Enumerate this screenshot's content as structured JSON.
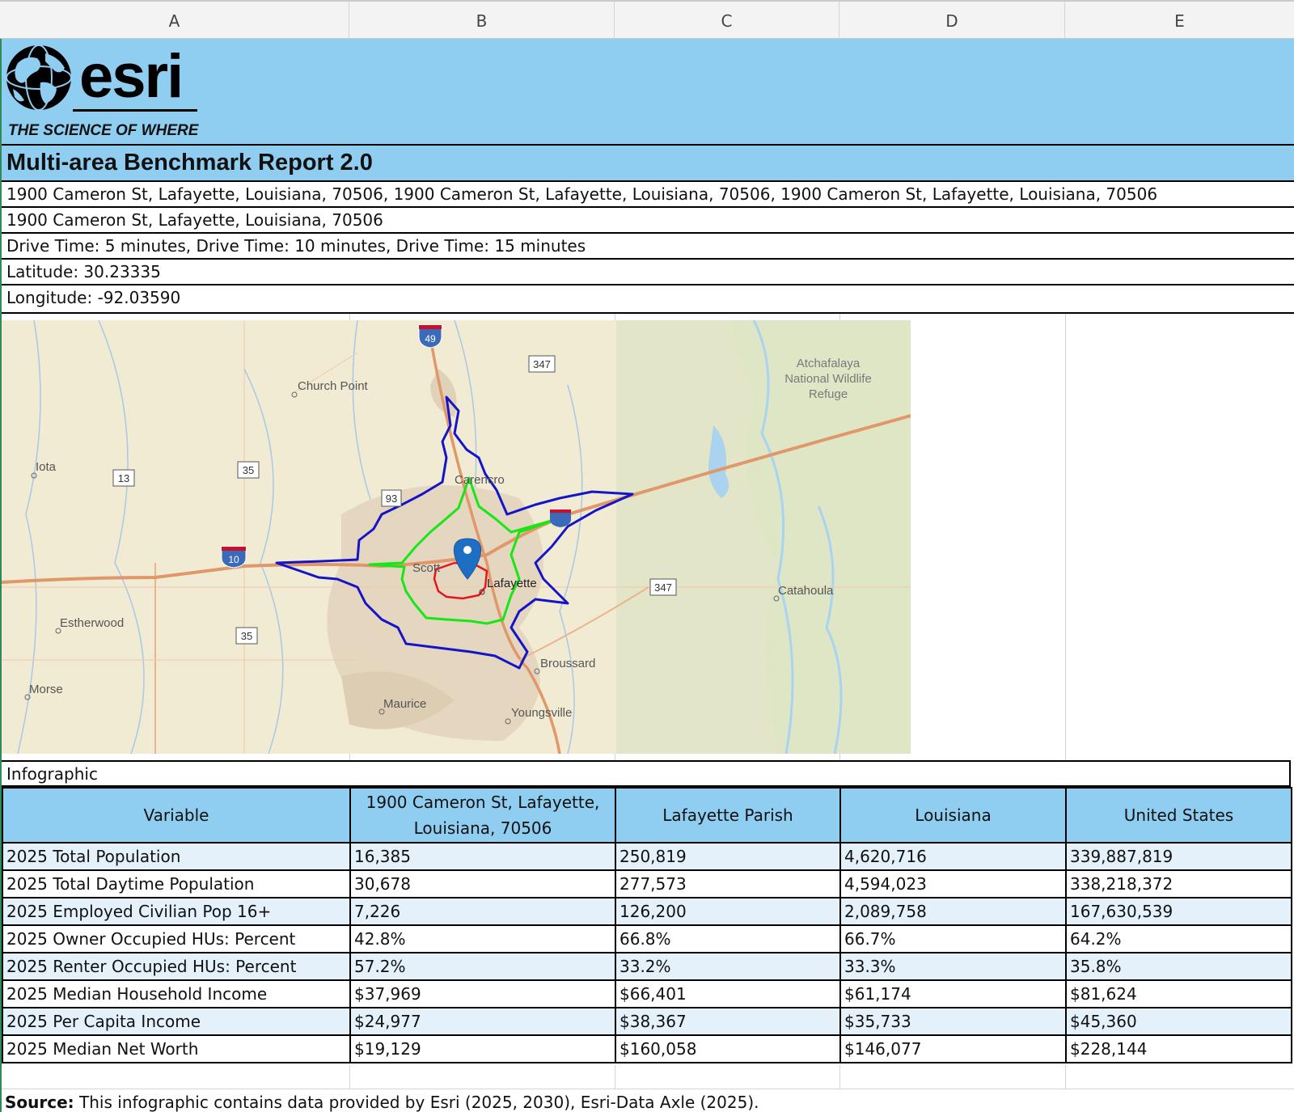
{
  "columns": [
    "A",
    "B",
    "C",
    "D",
    "E"
  ],
  "logo": {
    "word": "esri",
    "tagline": "THE SCIENCE OF WHERE",
    "brand_color": "#000000"
  },
  "report": {
    "title": "Multi-area Benchmark Report 2.0",
    "addresses": "1900 Cameron St, Lafayette, Louisiana, 70506, 1900 Cameron St, Lafayette, Louisiana, 70506, 1900 Cameron St, Lafayette, Louisiana, 70506",
    "address": "1900 Cameron St, Lafayette, Louisiana, 70506",
    "drive_times": "Drive Time: 5 minutes, Drive Time: 10 minutes, Drive Time: 15 minutes",
    "latitude": "Latitude: 30.23335",
    "longitude": "Longitude: -92.03590"
  },
  "map": {
    "labels": {
      "church_point": "Church Point",
      "iota": "Iota",
      "carencro": "Carencro",
      "scott": "Scott",
      "lafayette": "Lafayette",
      "estherwood": "Estherwood",
      "morse": "Morse",
      "maurice": "Maurice",
      "youngsville": "Youngsville",
      "broussard": "Broussard",
      "catahoula": "Catahoula",
      "refuge1": "Atchafalaya",
      "refuge2": "National Wildlife",
      "refuge3": "Refuge"
    },
    "shields": {
      "i49": "49",
      "i10": "10",
      "r347a": "347",
      "r347b": "347",
      "r13": "13",
      "r35a": "35",
      "r35b": "35",
      "r93": "93"
    },
    "ring_colors": {
      "5min": "#e8141c",
      "10min": "#17e617",
      "15min": "#1414c8"
    },
    "pin_color": "#1e6fc4"
  },
  "infographic_label": "Infographic",
  "table": {
    "headers": [
      "Variable",
      "1900 Cameron St, Lafayette, Louisiana, 70506",
      "Lafayette Parish",
      "Louisiana",
      "United States"
    ],
    "rows": [
      [
        "2025 Total Population",
        "16,385",
        "250,819",
        "4,620,716",
        "339,887,819"
      ],
      [
        "2025 Total Daytime Population",
        "30,678",
        "277,573",
        "4,594,023",
        "338,218,372"
      ],
      [
        "2025 Employed Civilian Pop 16+",
        "7,226",
        "126,200",
        "2,089,758",
        "167,630,539"
      ],
      [
        "2025 Owner Occupied HUs: Percent",
        "42.8%",
        "66.8%",
        "66.7%",
        "64.2%"
      ],
      [
        "2025 Renter Occupied HUs: Percent",
        "57.2%",
        "33.2%",
        "33.3%",
        "35.8%"
      ],
      [
        "2025 Median Household Income",
        "$37,969",
        "$66,401",
        "$61,174",
        "$81,624"
      ],
      [
        "2025 Per Capita Income",
        "$24,977",
        "$38,367",
        "$35,733",
        "$45,360"
      ],
      [
        "2025 Median Net Worth",
        "$19,129",
        "$160,058",
        "$146,077",
        "$228,144"
      ]
    ]
  },
  "source": {
    "label": "Source:",
    "text": " This infographic contains data provided by Esri (2025, 2030), Esri-Data Axle (2025)."
  }
}
